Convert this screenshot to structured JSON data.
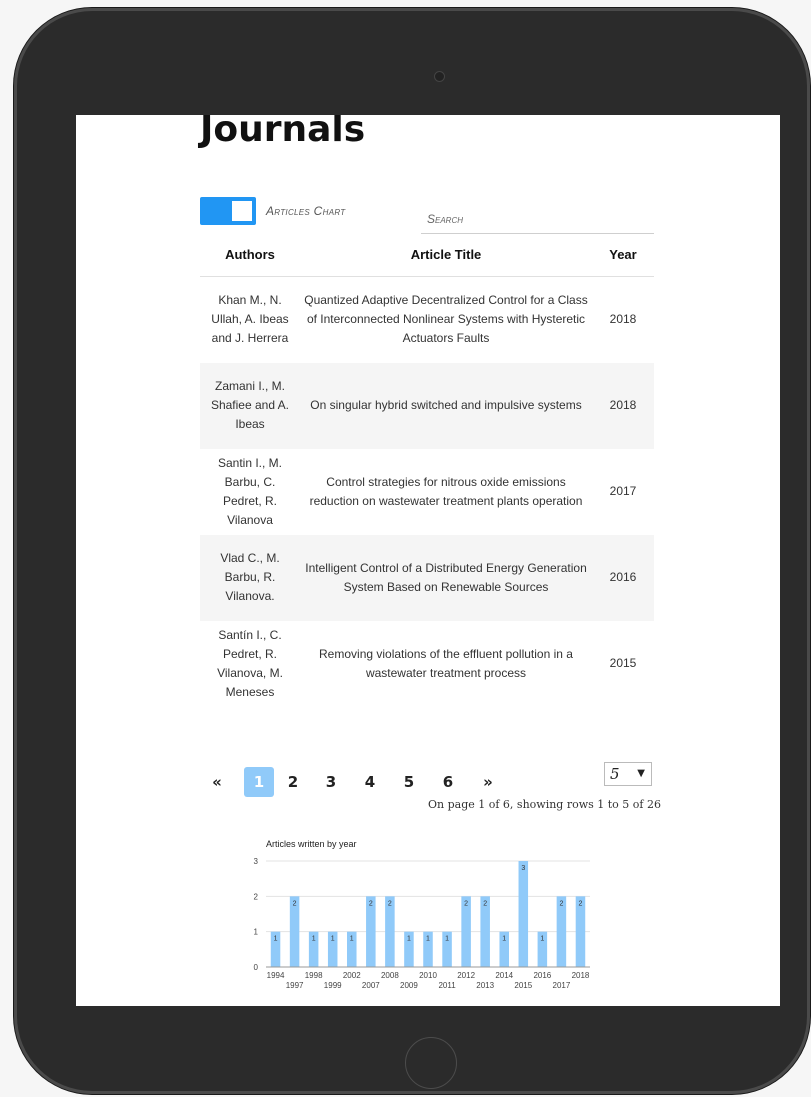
{
  "page": {
    "title": "Journals"
  },
  "toggle": {
    "label": "Articles Chart",
    "on": true
  },
  "search": {
    "placeholder": "Search",
    "value": ""
  },
  "table": {
    "headers": [
      "Authors",
      "Article Title",
      "Year"
    ],
    "rows": [
      {
        "authors": "Khan M., N. Ullah, A. Ibeas and J. Herrera",
        "title": "Quantized Adaptive Decentralized Control for a Class of Interconnected Nonlinear Systems with Hysteretic Actuators Faults",
        "year": "2018"
      },
      {
        "authors": "Zamani I., M. Shafiee and A. Ibeas",
        "title": "On singular hybrid switched and impulsive systems",
        "year": "2018"
      },
      {
        "authors": "Santin I., M. Barbu, C. Pedret, R. Vilanova",
        "title": "Control strategies for nitrous oxide emissions reduction on wastewater treatment plants operation",
        "year": "2017"
      },
      {
        "authors": "Vlad C., M. Barbu, R. Vilanova.",
        "title": "Intelligent Control of a Distributed Energy Generation System Based on Renewable Sources",
        "year": "2016"
      },
      {
        "authors": "Santín I., C. Pedret, R. Vilanova, M. Meneses",
        "title": "Removing violations of the effluent pollution in a wastewater treatment process",
        "year": "2015"
      }
    ]
  },
  "pagination": {
    "prev": "«",
    "next": "»",
    "pages": [
      "1",
      "2",
      "3",
      "4",
      "5",
      "6"
    ],
    "current": "1",
    "page_size": "5",
    "status": "On page 1 of 6, showing rows 1 to 5 of 26"
  },
  "chart_data": {
    "type": "bar",
    "title": "Articles written by year",
    "categories": [
      "1994",
      "1997",
      "1998",
      "1999",
      "2002",
      "2007",
      "2008",
      "2009",
      "2010",
      "2011",
      "2012",
      "2013",
      "2014",
      "2015",
      "2016",
      "2017",
      "2018"
    ],
    "values": [
      1,
      2,
      1,
      1,
      1,
      2,
      2,
      1,
      1,
      1,
      2,
      2,
      1,
      3,
      1,
      2,
      2
    ],
    "ylim": [
      0,
      3
    ],
    "yticks": [
      0,
      1,
      2,
      3
    ],
    "grid": true,
    "bar_color": "#90caf9"
  },
  "colors": {
    "accent": "#2196f3",
    "active_page": "#90caf9"
  }
}
